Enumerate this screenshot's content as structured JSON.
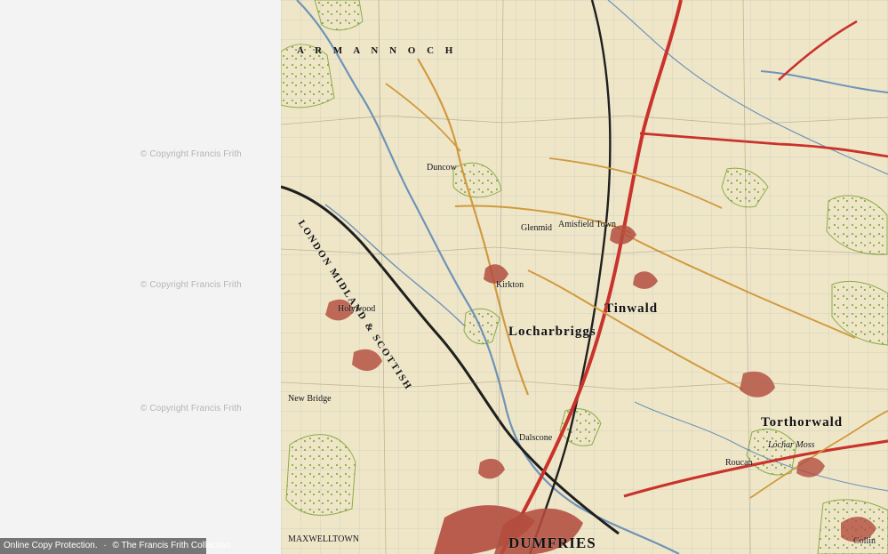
{
  "watermarks": [
    "© Copyright Francis Frith",
    "© Copyright Francis Frith",
    "© Copyright Francis Frith"
  ],
  "footer": {
    "protection": "Online Copy Protection.",
    "copyright": "© The Francis Frith Collection"
  },
  "map": {
    "labels": {
      "armannoch": "A R M A N N O C H",
      "holywood": "Holywood",
      "tinwald": "Tinwald",
      "torthorwald": "Torthorwald",
      "lochar_moss": "Lochar Moss",
      "kirkton": "Kirkton",
      "locharbriggs": "Locharbriggs",
      "amisfield_town": "Amisfield Town",
      "dumfries": "DUMFRIES",
      "maxwelltown": "MAXWELLTOWN",
      "collin": "Collin",
      "roucan": "Roucan",
      "glenmid": "Glenmid",
      "newbridge": "New Bridge",
      "dalscone": "Dalscone",
      "duncow": "Duncow",
      "rail_label": "LONDON MIDLAND & SCOTTISH"
    },
    "colors": {
      "paper": "#efe6c8",
      "grid": "#7f8ea0",
      "water": "#6f93b8",
      "rail": "#1f1f1f",
      "main_road": "#c9332b",
      "minor_road": "#d19a3e",
      "woodland": "#bfd55a",
      "woodland_dark": "#8fb03c",
      "town": "#b34d3f"
    }
  }
}
